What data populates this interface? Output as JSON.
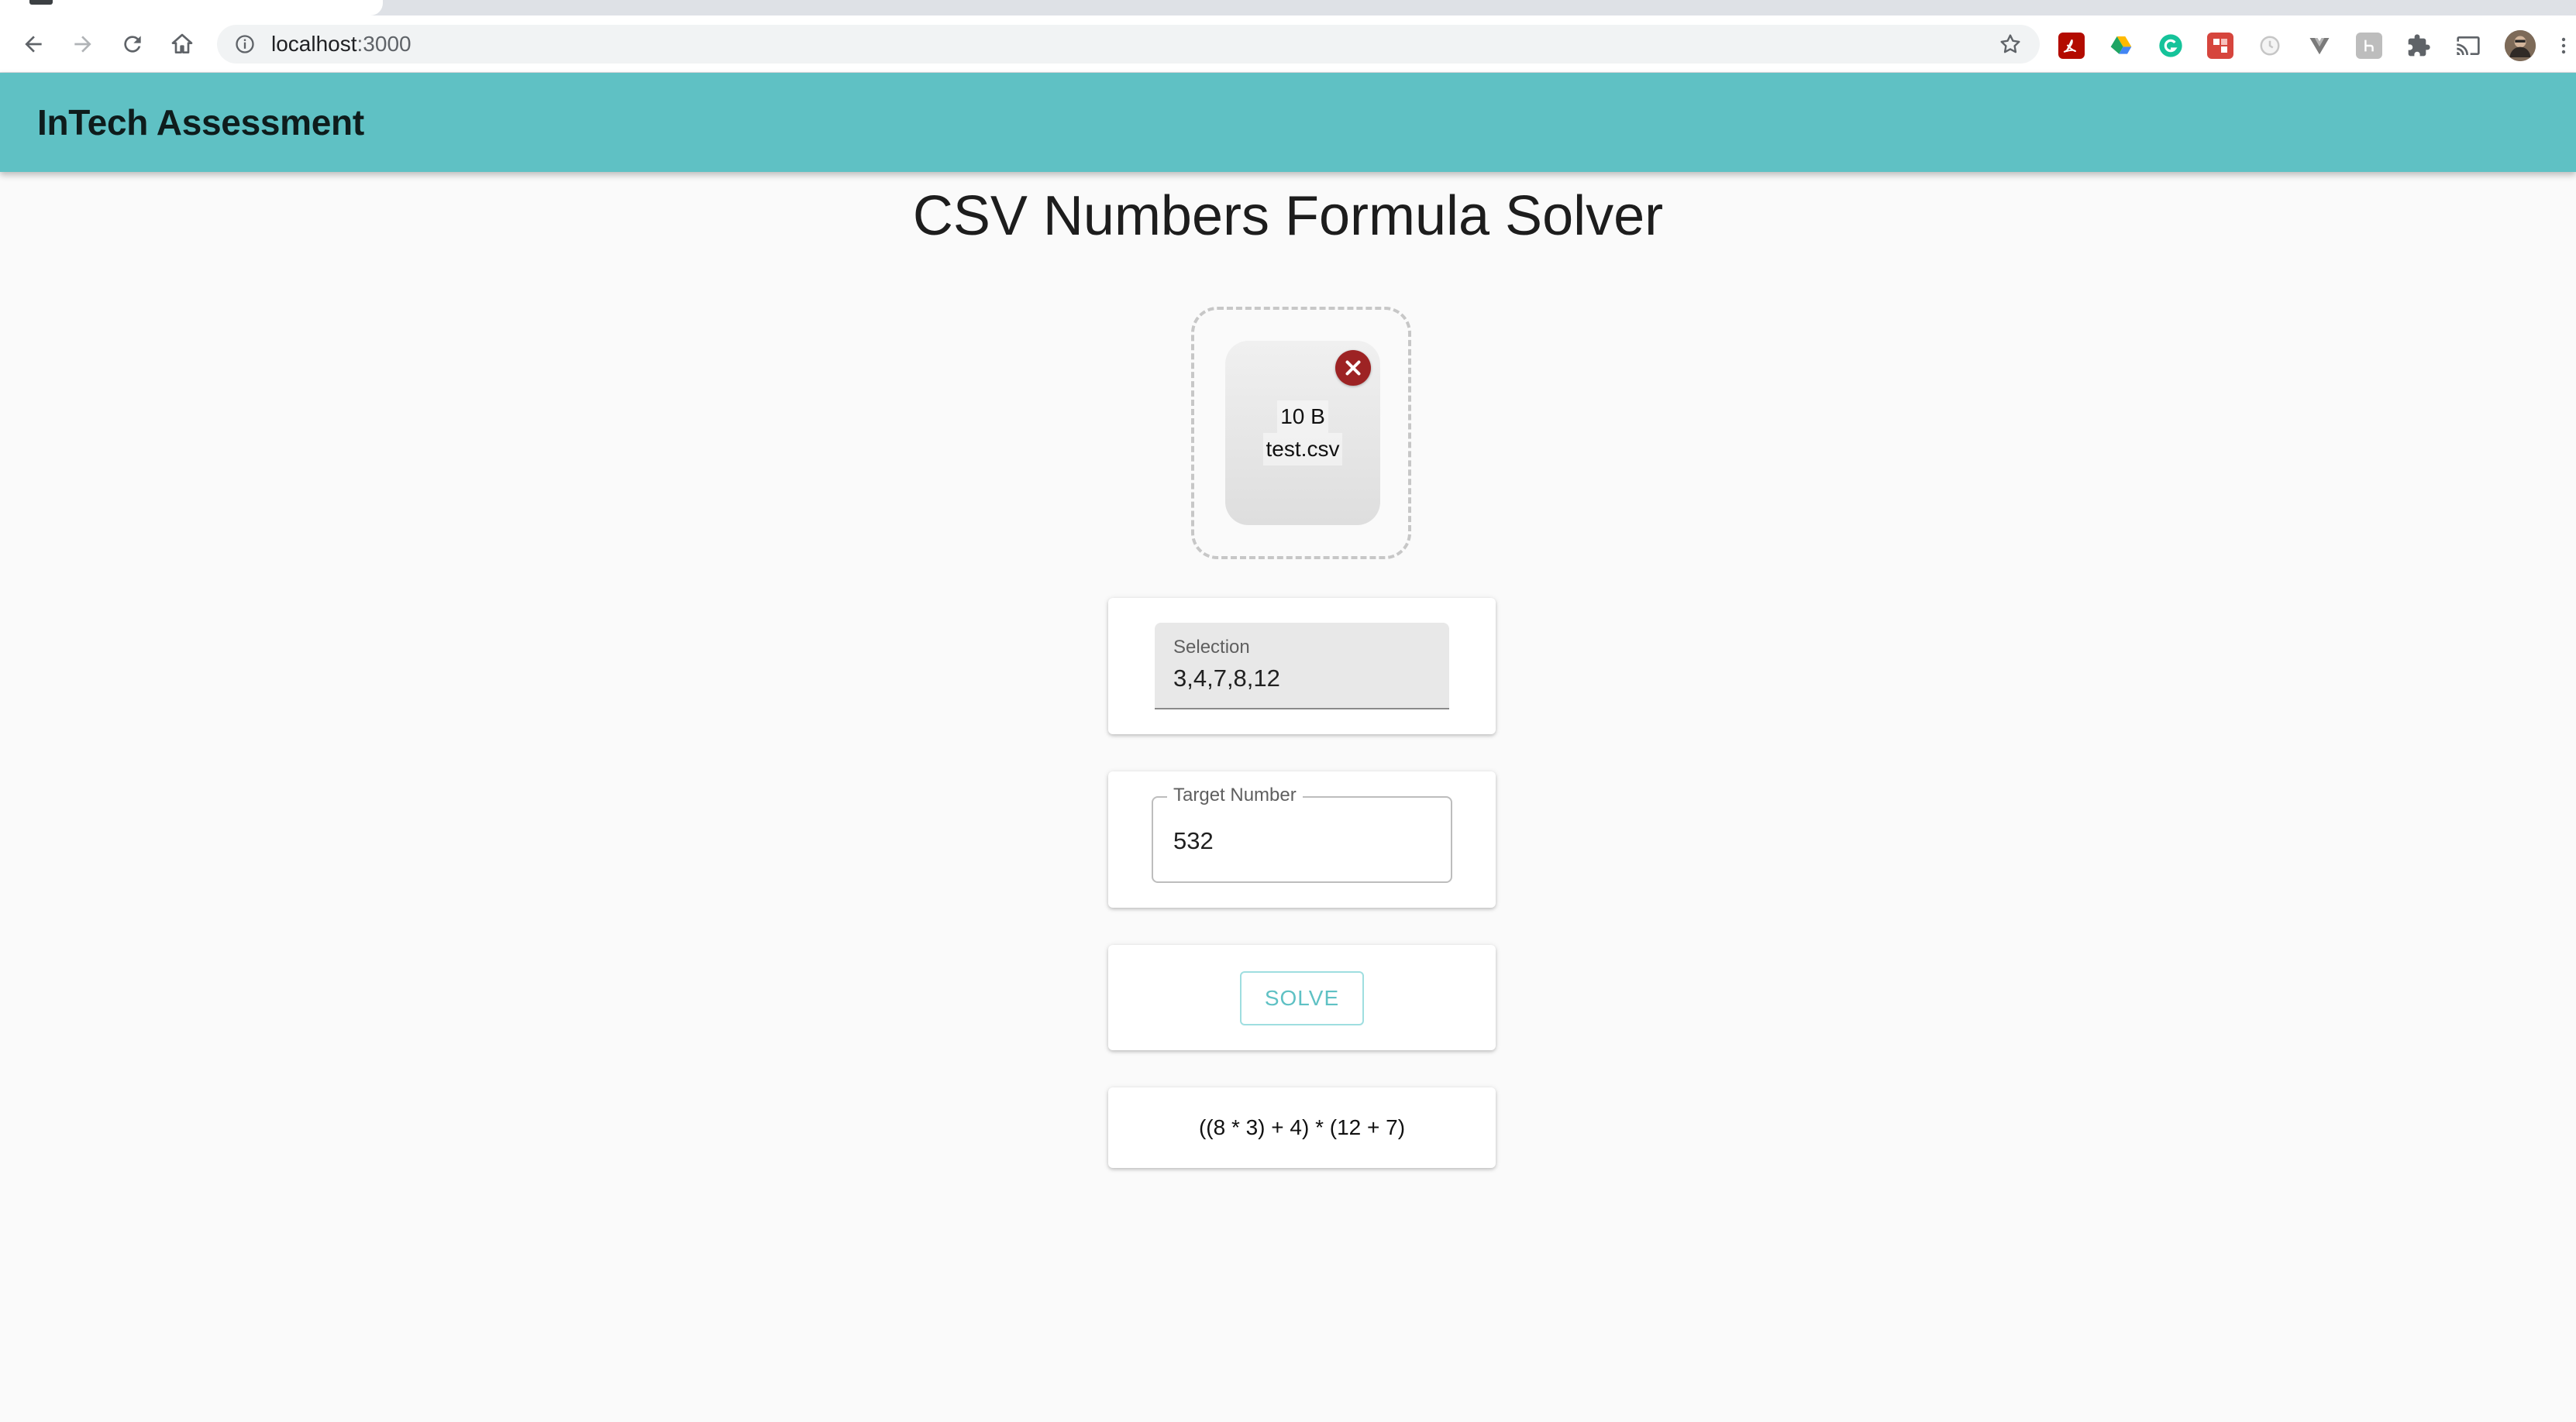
{
  "browser": {
    "url_host": "localhost",
    "url_port": ":3000",
    "nav": {
      "back_icon": "arrow-left-icon",
      "forward_icon": "arrow-right-icon",
      "reload_icon": "reload-icon",
      "home_icon": "home-icon"
    },
    "extensions": [
      {
        "name": "acrobat-extension-icon",
        "color": "#b30b00"
      },
      {
        "name": "google-drive-extension-icon",
        "color": "#1fa463"
      },
      {
        "name": "grammarly-extension-icon",
        "color": "#15c39a"
      },
      {
        "name": "extension-red-icon",
        "color": "#d6453d"
      },
      {
        "name": "extension-clock-icon",
        "color": "#cccccc"
      },
      {
        "name": "vue-devtools-extension-icon",
        "color": "#777777"
      },
      {
        "name": "extension-h-icon",
        "color": "#bbbbbb"
      },
      {
        "name": "extensions-puzzle-icon",
        "color": "#5f6368"
      },
      {
        "name": "cast-icon",
        "color": "#5f6368"
      },
      {
        "name": "profile-avatar",
        "color": "#6b5a4a"
      },
      {
        "name": "menu-kebab-icon",
        "color": "#5f6368"
      }
    ]
  },
  "appbar": {
    "title": "InTech Assessment",
    "color": "#5fc1c4"
  },
  "main": {
    "title": "CSV Numbers Formula Solver",
    "dropzone": {
      "file_size": "10 B",
      "file_name": "test.csv",
      "remove_icon": "close-icon",
      "remove_color": "#9d2324"
    },
    "selection": {
      "label": "Selection",
      "value": "3,4,7,8,12"
    },
    "target": {
      "label": "Target Number",
      "value": "532"
    },
    "solve_label": "SOLVE",
    "result": "((8 * 3) + 4) * (12 + 7)"
  }
}
